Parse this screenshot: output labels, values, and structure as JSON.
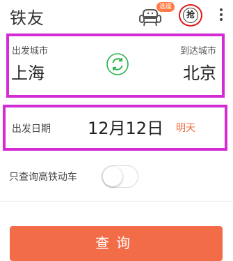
{
  "header": {
    "title": "铁友",
    "seat_icon": "sofa-icon",
    "seat_badge": "选座",
    "grab_label": "抢",
    "more_icon": "more-vertical-icon"
  },
  "route": {
    "from_label": "出发城市",
    "from_city": "上海",
    "to_label": "到达城市",
    "to_city": "北京",
    "swap_icon": "swap-refresh-icon",
    "swap_color": "#2bb24c"
  },
  "date": {
    "label": "出发日期",
    "value": "12月12日",
    "day": "明天"
  },
  "options": {
    "gd_only_label": "只查询高铁动车",
    "gd_only_on": false
  },
  "search": {
    "label": "查询"
  },
  "colors": {
    "highlight_border": "#d42bd4",
    "accent": "#f26c47",
    "grab_ring": "#e01818"
  }
}
